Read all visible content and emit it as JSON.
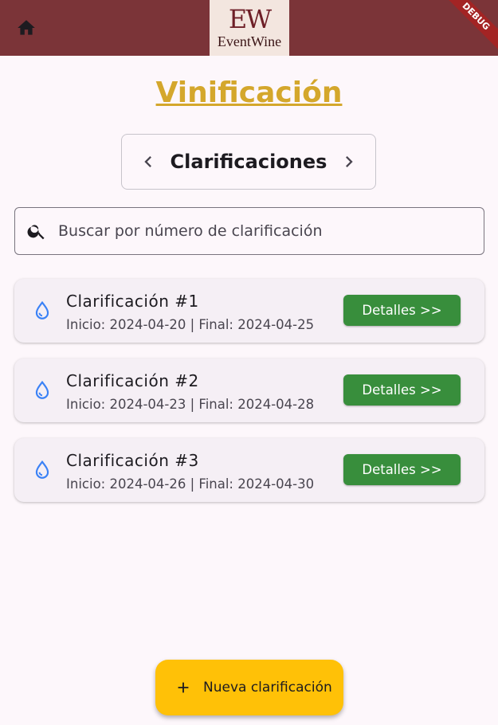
{
  "app_bar": {
    "home_icon": "home-icon",
    "logo_mark": "EW",
    "logo_text": "EventWine",
    "debug_banner": "DEBUG",
    "background": "#7b3438"
  },
  "page": {
    "title": "Vinificación",
    "title_color": "#d4a72c"
  },
  "switcher": {
    "label": "Clarificaciones",
    "prev_icon": "chevron-left-icon",
    "next_icon": "chevron-right-icon"
  },
  "search": {
    "placeholder": "Buscar por número de clarificación",
    "value": "",
    "icon": "search-icon"
  },
  "clarifications": [
    {
      "title": "Clarificación #1",
      "subtitle": "Inicio: 2024-04-20 | Final: 2024-04-25",
      "button": "Detalles >>",
      "icon": "water-drop-icon"
    },
    {
      "title": "Clarificación #2",
      "subtitle": "Inicio: 2024-04-23 | Final: 2024-04-28",
      "button": "Detalles >>",
      "icon": "water-drop-icon"
    },
    {
      "title": "Clarificación #3",
      "subtitle": "Inicio: 2024-04-26 | Final: 2024-04-30",
      "button": "Detalles >>",
      "icon": "water-drop-icon"
    }
  ],
  "fab": {
    "label": "Nueva clarificación",
    "icon": "add-icon",
    "color": "#ffc107"
  },
  "colors": {
    "details_button": "#388e3c",
    "drop_icon": "#3b82f6"
  }
}
